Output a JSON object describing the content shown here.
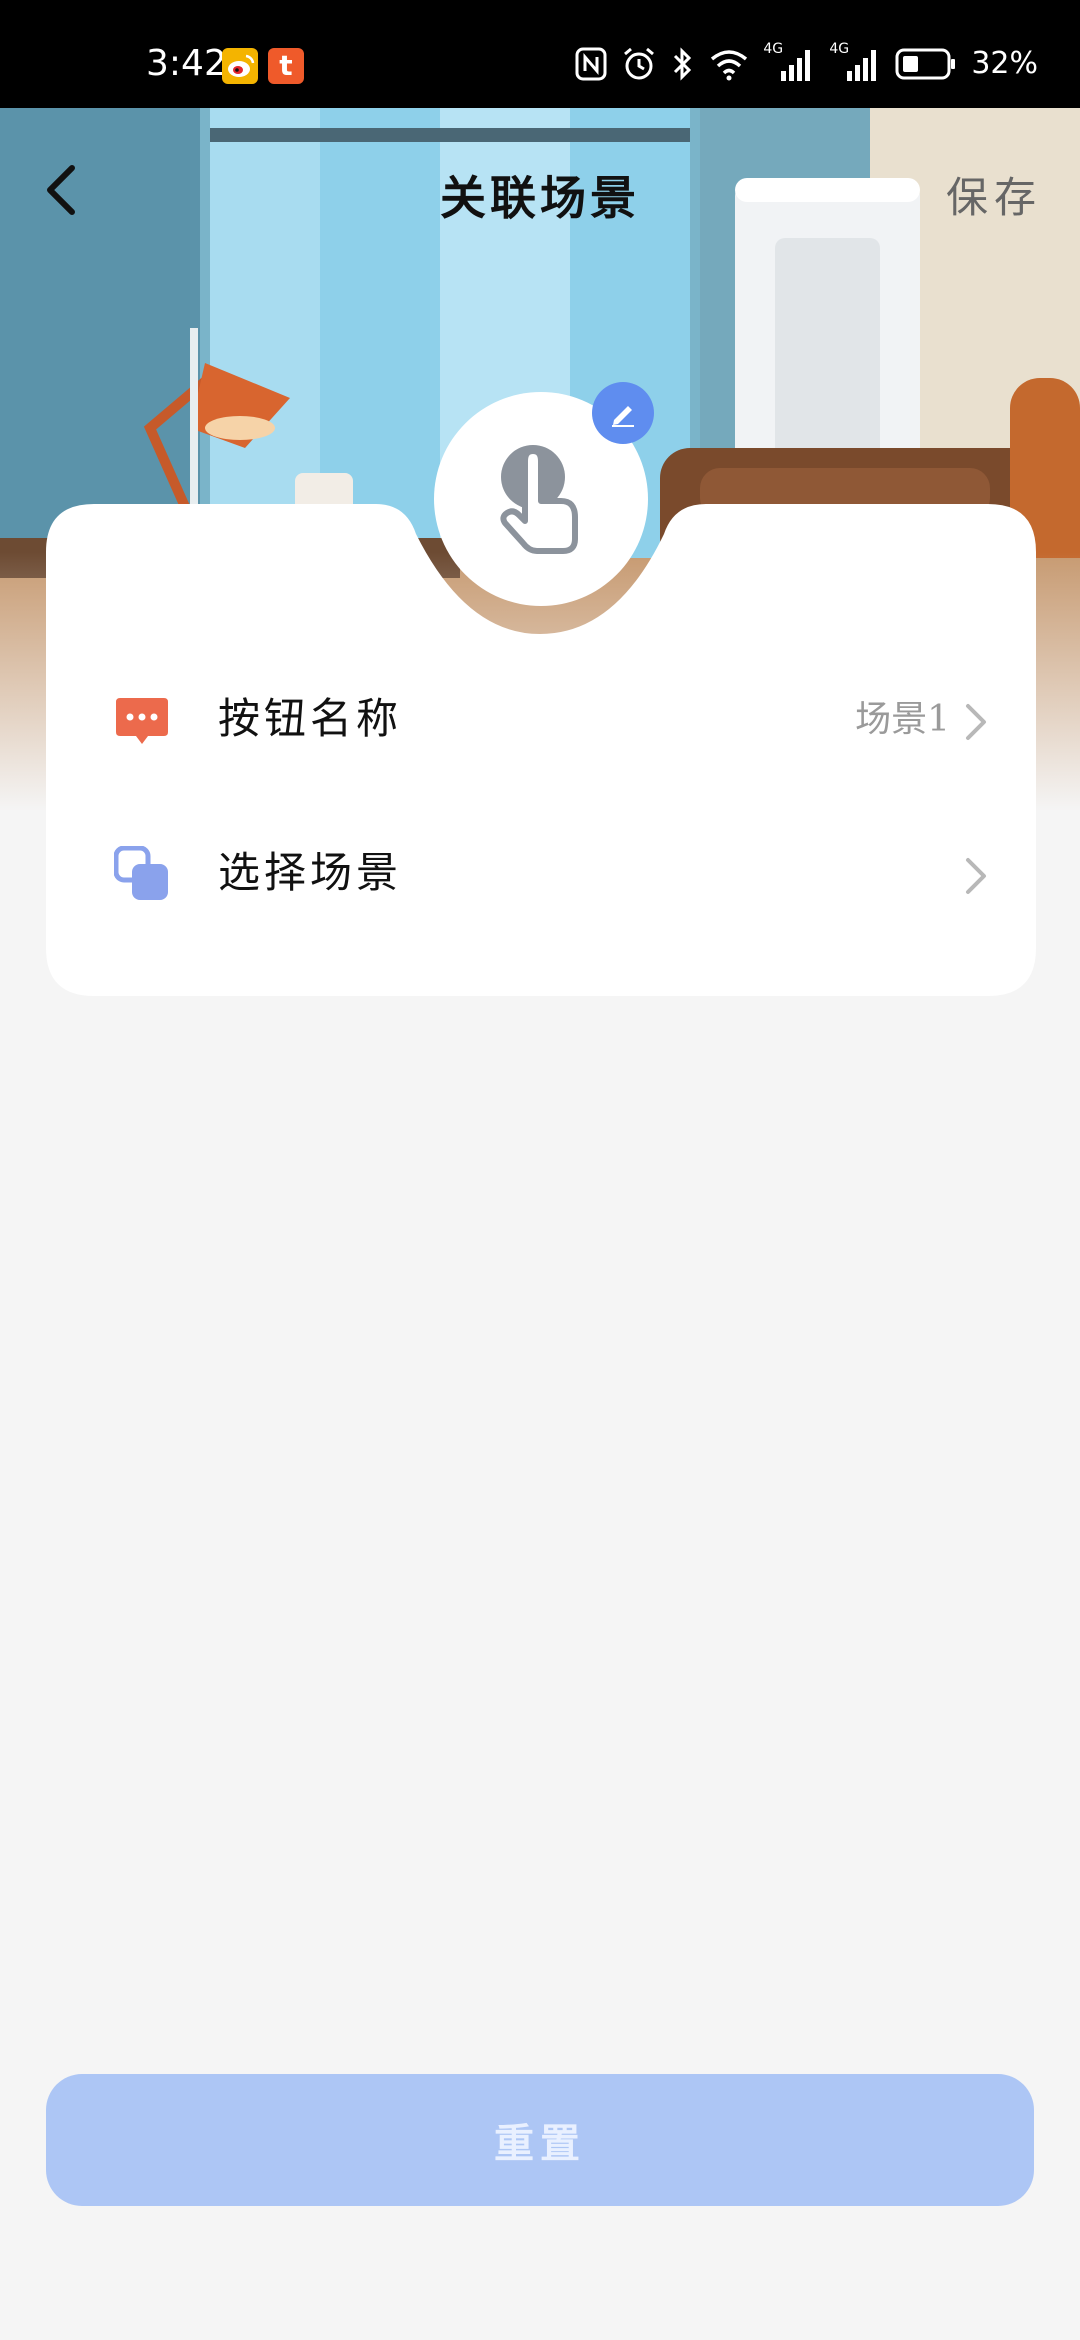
{
  "status_bar": {
    "time": "3:42",
    "battery": "32%",
    "network_label_1": "4G",
    "network_label_2": "4G"
  },
  "header": {
    "title": "关联场景",
    "save_label": "保存"
  },
  "rows": [
    {
      "label": "按钮名称",
      "value": "场景1"
    },
    {
      "label": "选择场景",
      "value": ""
    }
  ],
  "footer": {
    "reset_label": "重置"
  },
  "colors": {
    "accent": "#5f8def",
    "button_bg": "#adc6f5",
    "name_icon": "#ec6a4c",
    "scene_icon": "#8aa2ec",
    "background": "#f5f5f5"
  },
  "icons": {
    "back": "chevron-left-icon",
    "edit": "pencil-icon",
    "avatar": "tap-hand-icon",
    "name_row": "chat-bubble-icon",
    "scene_row": "overlapping-squares-icon",
    "arrow": "chevron-right-icon"
  }
}
